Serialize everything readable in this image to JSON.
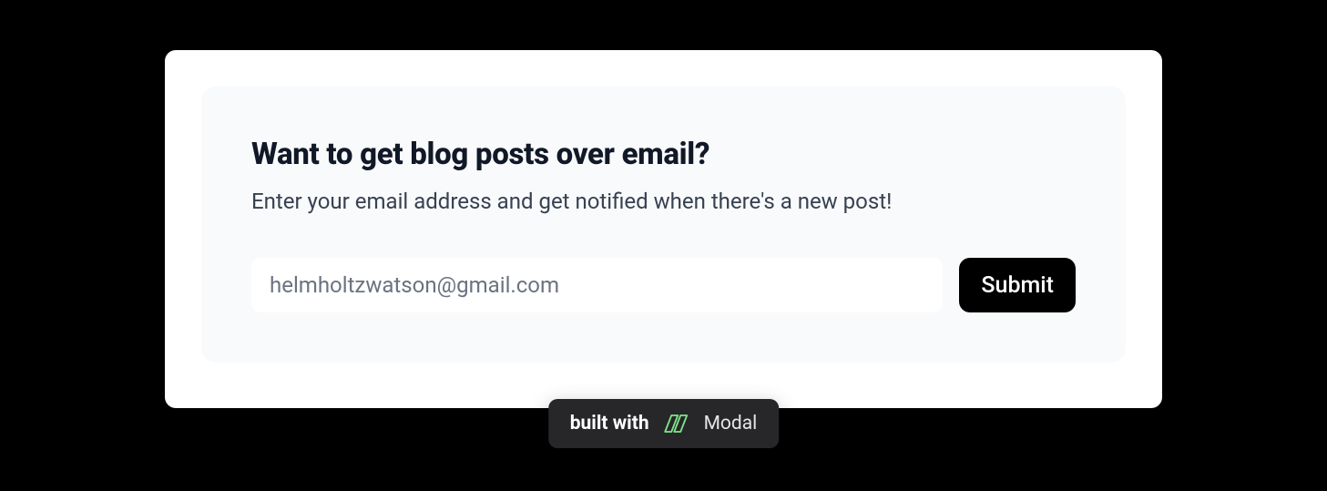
{
  "signup": {
    "heading": "Want to get blog posts over email?",
    "subheading": "Enter your email address and get notified when there's a new post!",
    "email_placeholder": "helmholtzwatson@gmail.com",
    "submit_label": "Submit"
  },
  "badge": {
    "built_with": "built with",
    "brand": "Modal"
  }
}
